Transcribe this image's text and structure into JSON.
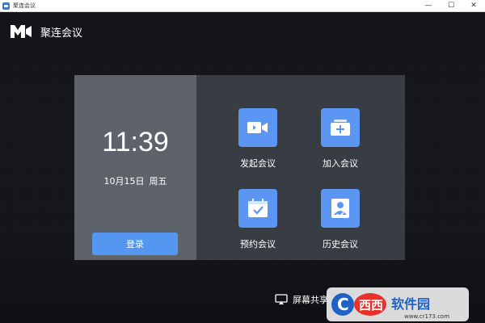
{
  "window": {
    "title": "聚连会议",
    "minimize": "—",
    "maximize": "☐",
    "close": "✕"
  },
  "header": {
    "app_name": "聚连会议",
    "logo_icon": "camera-logo-icon"
  },
  "status": {
    "time": "11:39",
    "date": "10月15日",
    "weekday": "周五"
  },
  "login": {
    "label": "登录"
  },
  "actions": [
    {
      "label": "发起会议",
      "icon": "video-camera-icon"
    },
    {
      "label": "加入会议",
      "icon": "join-plus-icon"
    },
    {
      "label": "预约会议",
      "icon": "calendar-check-icon"
    },
    {
      "label": "历史会议",
      "icon": "user-history-icon"
    }
  ],
  "screen_share": {
    "label": "屏幕共享",
    "icon": "cast-screen-icon"
  },
  "watermark": {
    "text": "软件园",
    "subtext": "www.cr173.com"
  },
  "colors": {
    "accent": "#5a96f2",
    "login_button": "#5596f0",
    "card_left": "#5d626b",
    "card_right": "#3e4249"
  }
}
